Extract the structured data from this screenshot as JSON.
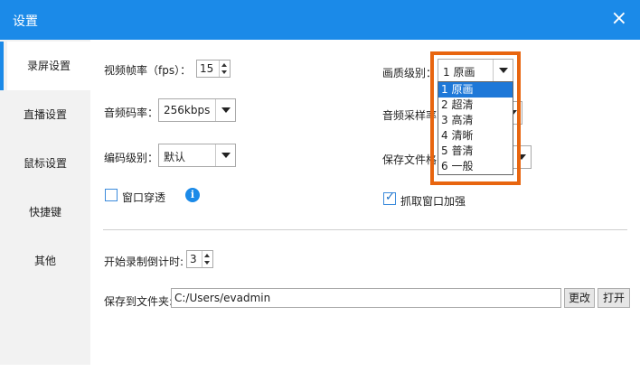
{
  "window": {
    "title": "设置",
    "close": "×"
  },
  "sidebar": {
    "items": [
      {
        "label": "录屏设置"
      },
      {
        "label": "直播设置"
      },
      {
        "label": "鼠标设置"
      },
      {
        "label": "快捷键"
      },
      {
        "label": "其他"
      }
    ]
  },
  "record": {
    "fps_label": "视频帧率（fps）：",
    "fps_value": "15",
    "bitrate_label": "音频码率：",
    "bitrate_value": "256kbps",
    "encode_label": "编码级别：",
    "encode_value": "默认",
    "pass_through_label": "窗口穿透",
    "pass_through_checked": false,
    "info_icon": "i",
    "quality_label": "画质级别：",
    "quality_value": "1 原画",
    "sample_label": "音频采样率",
    "save_format_label": "保存文件格",
    "capture_enhance_label": "抓取窗口加强",
    "capture_enhance_checked": true,
    "countdown_label": "开始录制倒计时:",
    "countdown_value": "3",
    "save_folder_label": "保存到文件夹:",
    "save_folder_value": "C:/Users/evadmin",
    "change_button": "更改",
    "open_button": "打开"
  },
  "quality_dropdown": {
    "options": [
      "1 原画",
      "2 超清",
      "3 高清",
      "4 清晰",
      "5 普清",
      "6 一般"
    ],
    "selected_index": 0
  },
  "colors": {
    "accent": "#1b8ae8",
    "highlight": "#e8650f",
    "selected": "#1e78d8"
  }
}
